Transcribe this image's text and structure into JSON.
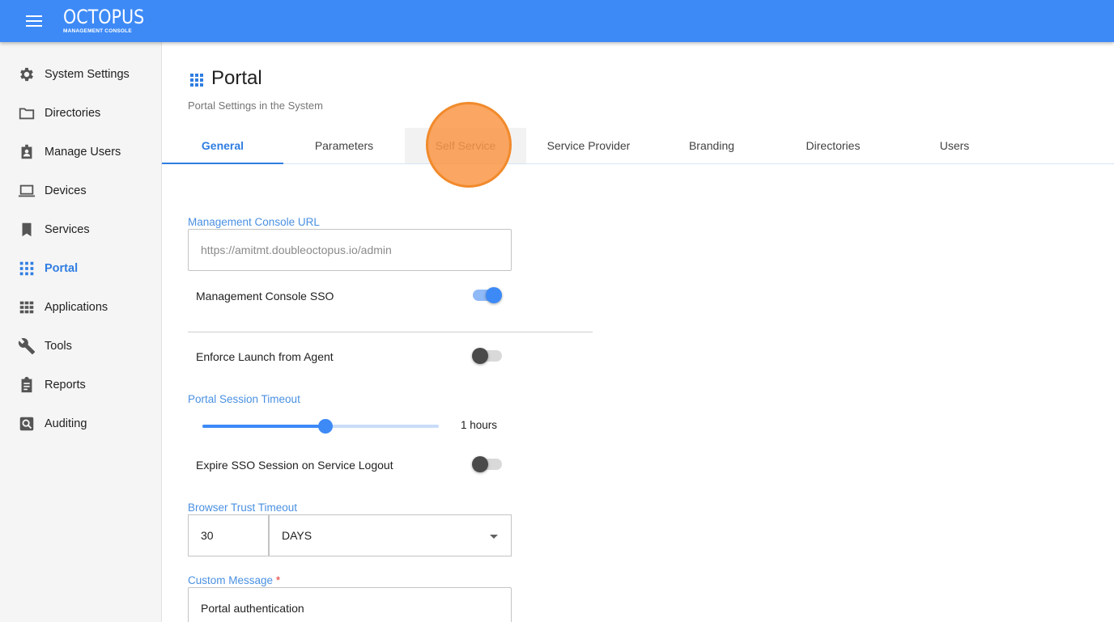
{
  "app": {
    "logo_title": "OCTOPUS",
    "logo_subtitle": "MANAGEMENT CONSOLE",
    "accent_color": "#3d8af7"
  },
  "sidebar": {
    "items": [
      {
        "label": "System Settings",
        "icon": "gear-icon"
      },
      {
        "label": "Directories",
        "icon": "folder-icon"
      },
      {
        "label": "Manage Users",
        "icon": "user-badge-icon"
      },
      {
        "label": "Devices",
        "icon": "laptop-icon"
      },
      {
        "label": "Services",
        "icon": "bookmark-icon"
      },
      {
        "label": "Portal",
        "icon": "grid-icon",
        "active": true
      },
      {
        "label": "Applications",
        "icon": "apps-icon"
      },
      {
        "label": "Tools",
        "icon": "wrench-icon"
      },
      {
        "label": "Reports",
        "icon": "clipboard-icon"
      },
      {
        "label": "Auditing",
        "icon": "search-box-icon"
      }
    ]
  },
  "page": {
    "title": "Portal",
    "subtitle": "Portal Settings in the System"
  },
  "tabs": [
    {
      "label": "General",
      "active": true
    },
    {
      "label": "Parameters"
    },
    {
      "label": "Self Service"
    },
    {
      "label": "Service Provider"
    },
    {
      "label": "Branding"
    },
    {
      "label": "Directories"
    },
    {
      "label": "Users"
    }
  ],
  "form": {
    "console_url": {
      "label": "Management Console URL",
      "placeholder": "https://amitmt.doubleoctopus.io/admin"
    },
    "console_sso": {
      "label": "Management Console SSO",
      "on": true
    },
    "enforce_agent": {
      "label": "Enforce Launch from Agent",
      "on": false
    },
    "session_timeout": {
      "label": "Portal Session Timeout",
      "value_text": "1 hours",
      "fill_fraction": 0.52
    },
    "expire_sso": {
      "label": "Expire SSO Session on Service Logout",
      "on": false
    },
    "browser_trust": {
      "label": "Browser Trust Timeout",
      "amount": "30",
      "unit": "DAYS"
    },
    "custom_message": {
      "label": "Custom Message",
      "required_mark": "*",
      "value": "Portal authentication"
    }
  }
}
